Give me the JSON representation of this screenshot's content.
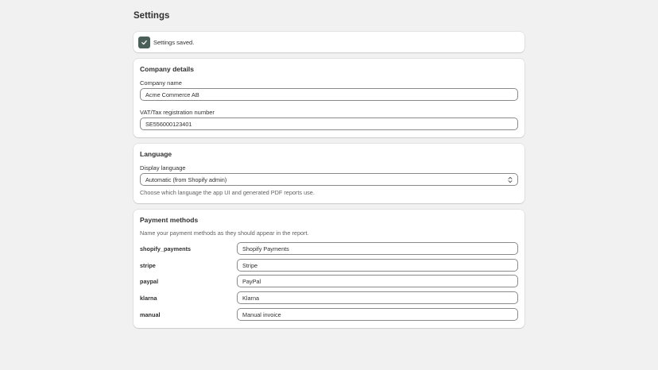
{
  "page": {
    "title": "Settings"
  },
  "banner": {
    "text": "Settings saved."
  },
  "company": {
    "title": "Company details",
    "name_label": "Company name",
    "name_value": "Acme Commerce AB",
    "vat_label": "VAT/Tax registration number",
    "vat_value": "SE556000123401"
  },
  "language": {
    "title": "Language",
    "display_label": "Display language",
    "selected": "Automatic (from Shopify admin)",
    "help": "Choose which language the app UI and generated PDF reports use."
  },
  "payments": {
    "title": "Payment methods",
    "description": "Name your payment methods as they should appear in the report.",
    "methods": [
      {
        "key": "shopify_payments",
        "value": "Shopify Payments"
      },
      {
        "key": "stripe",
        "value": "Stripe"
      },
      {
        "key": "paypal",
        "value": "PayPal"
      },
      {
        "key": "klarna",
        "value": "Klarna"
      },
      {
        "key": "manual",
        "value": "Manual invoice"
      }
    ]
  }
}
